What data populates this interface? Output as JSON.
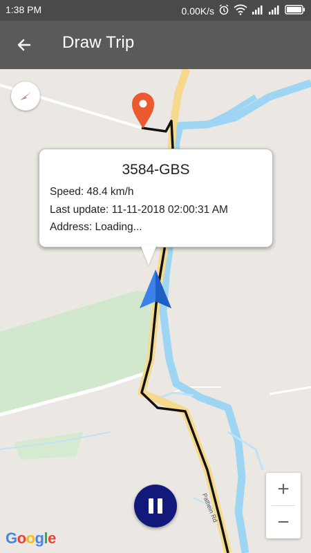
{
  "status_bar": {
    "time": "1:38 PM",
    "net_speed": "0.00K/s"
  },
  "app_bar": {
    "title": "Draw Trip"
  },
  "info_window": {
    "vehicle_id": "3584-GBS",
    "speed": "Speed: 48.4 km/h",
    "last_update": "Last update: 11-11-2018 02:00:31 AM",
    "address": "Address: Loading..."
  },
  "map": {
    "road_label": "Pathein Rd"
  },
  "zoom": {
    "in_label": "+",
    "out_label": "−"
  },
  "google": {
    "letters": [
      "G",
      "o",
      "o",
      "g",
      "l",
      "e"
    ],
    "colors": [
      "#4285F4",
      "#EA4335",
      "#FBBC05",
      "#4285F4",
      "#34A853",
      "#EA4335"
    ]
  }
}
